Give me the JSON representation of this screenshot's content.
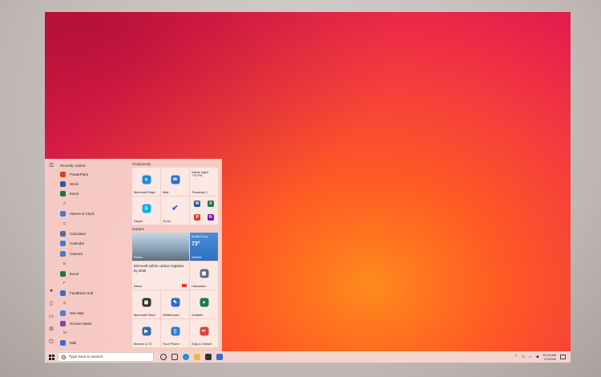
{
  "start_menu": {
    "recently_added_label": "Recently added",
    "apps": [
      {
        "type": "app",
        "label": "PowerPoint",
        "color": "#d04423"
      },
      {
        "type": "app",
        "label": "Word",
        "color": "#2b579a"
      },
      {
        "type": "app",
        "label": "Excel",
        "color": "#217346"
      },
      {
        "type": "letter",
        "label": "A"
      },
      {
        "type": "app",
        "label": "Alarms & Clock",
        "color": "#3a7bd5"
      },
      {
        "type": "letter",
        "label": "C"
      },
      {
        "type": "app",
        "label": "Calculator",
        "color": "#4a6fa5"
      },
      {
        "type": "app",
        "label": "Calendar",
        "color": "#3b7dd8"
      },
      {
        "type": "app",
        "label": "Camera",
        "color": "#4a7ac0"
      },
      {
        "type": "letter",
        "label": "E"
      },
      {
        "type": "app",
        "label": "Excel",
        "color": "#217346"
      },
      {
        "type": "letter",
        "label": "F"
      },
      {
        "type": "app",
        "label": "Feedback Hub",
        "color": "#3a6fc4"
      },
      {
        "type": "letter",
        "label": "G"
      },
      {
        "type": "app",
        "label": "Get Help",
        "color": "#3b82d8"
      },
      {
        "type": "app",
        "label": "Groove Music",
        "color": "#6b4fbf"
      },
      {
        "type": "letter",
        "label": "M"
      },
      {
        "type": "app",
        "label": "Mail",
        "color": "#2f6fd0"
      }
    ],
    "groups": {
      "productivity": "Productivity",
      "explore": "Explore"
    },
    "tiles": {
      "edge": "Microsoft Edge",
      "mail": "Mail",
      "game_night": "Game night",
      "game_time": "7:00 PM",
      "game_day": "Thursday 1",
      "skype": "Skype",
      "todo": "To Do",
      "news_headline": "Microsoft will be carbon negative by 2030",
      "news_label": "News",
      "photo_caption": "Photos",
      "weather_city": "Mostly Sunny",
      "weather_temp": "73°",
      "weather_label": "Weather",
      "calculator": "Calculator",
      "store": "Microsoft Store",
      "whiteboard": "Whiteboard",
      "solitaire": "Solitaire",
      "movies": "Movies & TV",
      "phone": "Your Phone",
      "snip": "Snip & Sketch"
    }
  },
  "taskbar": {
    "search_placeholder": "Type here to search",
    "clock_time": "10:15 AM",
    "clock_date": "7/1/2020"
  },
  "colors": {
    "edge": "#1e8fd6",
    "mail": "#2f6fd0",
    "skype": "#00aff0",
    "todo": "#2564cf",
    "store": "#333333",
    "whiteboard": "#2d6ec9",
    "solitaire": "#1f7a4d",
    "movies": "#2b6cb0",
    "phone": "#2e7bd6",
    "snip": "#d6453d",
    "calculator": "#5f6b7a"
  }
}
